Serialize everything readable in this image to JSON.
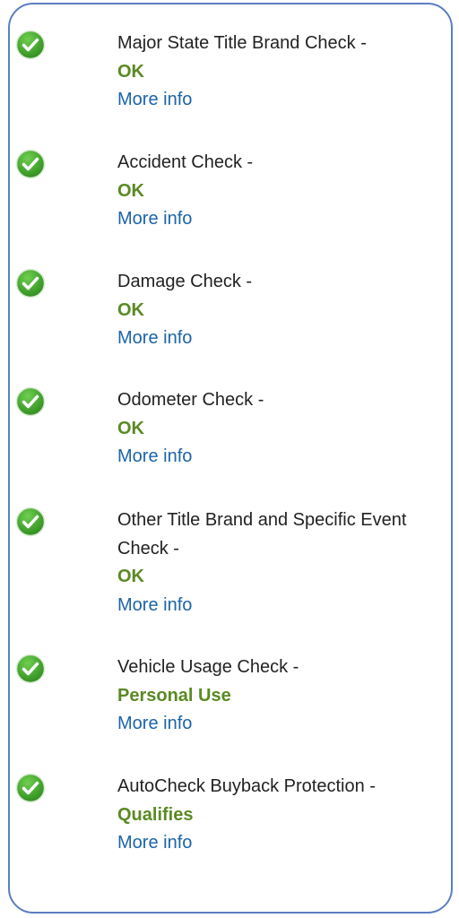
{
  "colors": {
    "border": "#5b7ec2",
    "title": "#222222",
    "status": "#5a8a23",
    "link": "#1c64a8",
    "check_icon": "#3f9a2c"
  },
  "checks": [
    {
      "title": "Major State Title Brand Check -",
      "status": "OK",
      "link": "More info",
      "icon": "check-circle-icon"
    },
    {
      "title": "Accident Check -",
      "status": "OK",
      "link": "More info",
      "icon": "check-circle-icon"
    },
    {
      "title": "Damage Check -",
      "status": "OK",
      "link": "More info",
      "icon": "check-circle-icon"
    },
    {
      "title": "Odometer Check -",
      "status": "OK",
      "link": "More info",
      "icon": "check-circle-icon"
    },
    {
      "title": "Other Title Brand and Specific Event Check -",
      "status": "OK",
      "link": "More info",
      "icon": "check-circle-icon"
    },
    {
      "title": "Vehicle Usage Check -",
      "status": "Personal Use",
      "link": "More info",
      "icon": "check-circle-icon"
    },
    {
      "title": "AutoCheck Buyback Protection -",
      "status": "Qualifies",
      "link": "More info",
      "icon": "check-circle-icon"
    }
  ]
}
